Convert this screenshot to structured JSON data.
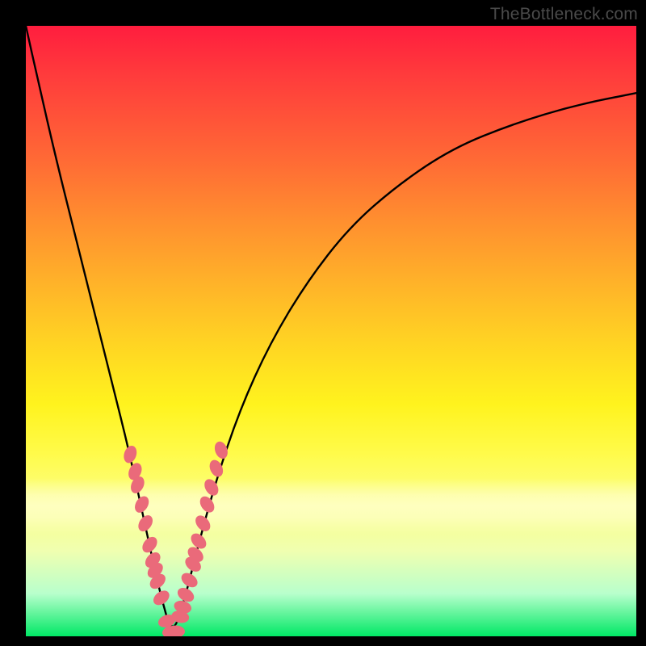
{
  "watermark": "TheBottleneck.com",
  "colors": {
    "frame": "#000000",
    "curve": "#000000",
    "marker_fill": "#ea6a7a",
    "marker_stroke": "#d85868",
    "gradient_top": "#ff1d3e",
    "gradient_bottom": "#00e865"
  },
  "chart_data": {
    "type": "line",
    "title": "",
    "xlabel": "",
    "ylabel": "",
    "xlim": [
      0,
      100
    ],
    "ylim": [
      0,
      100
    ],
    "grid": false,
    "legend": false,
    "note": "Axes are unlabeled in the source image; V-shaped bottleneck curve with minimum near x≈24. Values estimated from pixel positions.",
    "series": [
      {
        "name": "bottleneck-curve",
        "render": "line",
        "x": [
          0,
          2,
          5,
          8,
          11,
          14,
          17,
          20,
          22,
          24,
          26,
          28,
          31,
          35,
          40,
          46,
          53,
          61,
          70,
          80,
          90,
          100
        ],
        "y": [
          100,
          91,
          78,
          66,
          54,
          42,
          30,
          16,
          7,
          0,
          6,
          14,
          25,
          37,
          48,
          58,
          67,
          74,
          80,
          84,
          87,
          89
        ]
      },
      {
        "name": "highlighted-points",
        "render": "scatter",
        "x": [
          17.1,
          17.9,
          18.3,
          19.0,
          19.6,
          20.3,
          20.8,
          21.2,
          21.6,
          22.2,
          23.1,
          23.8,
          24.6,
          25.3,
          25.7,
          26.2,
          26.8,
          27.4,
          27.8,
          28.3,
          29.0,
          29.7,
          30.4,
          31.2,
          32.0
        ],
        "y": [
          29.8,
          27.0,
          24.8,
          21.6,
          18.5,
          15.0,
          12.5,
          10.8,
          9.0,
          6.3,
          2.5,
          0.7,
          0.8,
          3.2,
          4.8,
          6.8,
          9.2,
          11.8,
          13.4,
          15.6,
          18.5,
          21.6,
          24.4,
          27.5,
          30.5
        ]
      }
    ]
  }
}
